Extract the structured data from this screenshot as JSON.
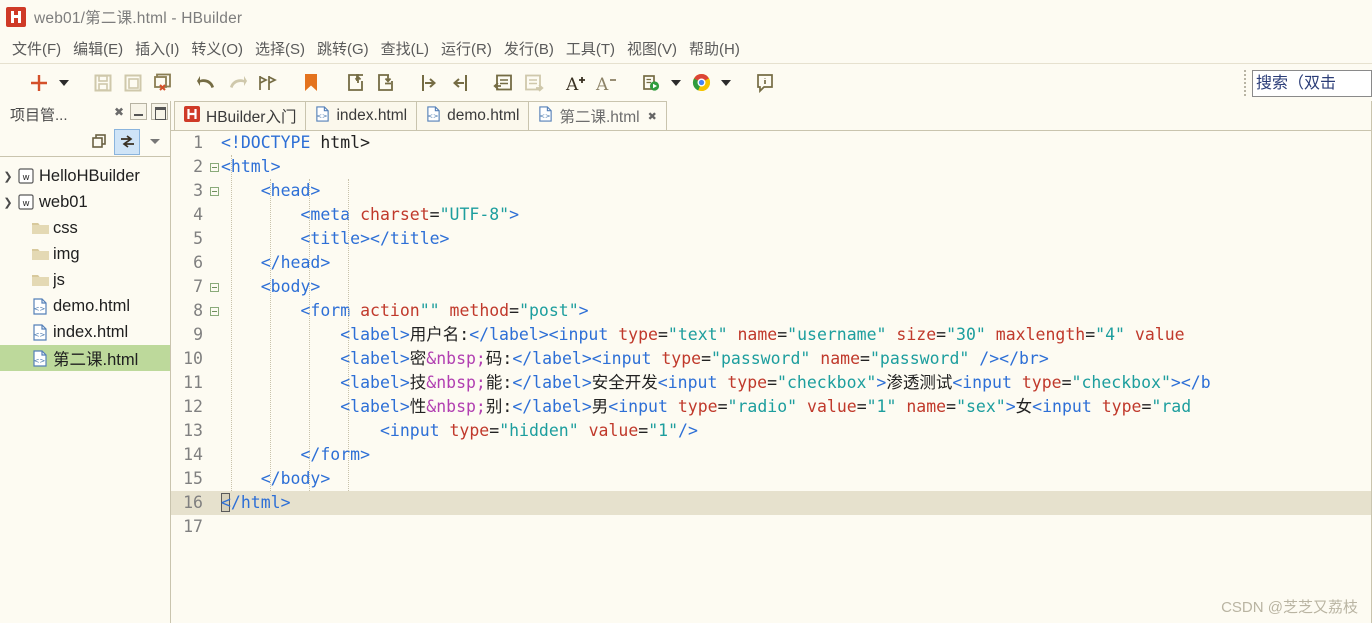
{
  "window": {
    "title": "web01/第二课.html  -  HBuilder",
    "logo_icon": "hbuilder-logo-icon"
  },
  "menubar": {
    "items": [
      {
        "label": "文件(F)",
        "name": "menu-file"
      },
      {
        "label": "编辑(E)",
        "name": "menu-edit"
      },
      {
        "label": "插入(I)",
        "name": "menu-insert"
      },
      {
        "label": "转义(O)",
        "name": "menu-escape"
      },
      {
        "label": "选择(S)",
        "name": "menu-select"
      },
      {
        "label": "跳转(G)",
        "name": "menu-goto"
      },
      {
        "label": "查找(L)",
        "name": "menu-find"
      },
      {
        "label": "运行(R)",
        "name": "menu-run"
      },
      {
        "label": "发行(B)",
        "name": "menu-publish"
      },
      {
        "label": "工具(T)",
        "name": "menu-tools"
      },
      {
        "label": "视图(V)",
        "name": "menu-view"
      },
      {
        "label": "帮助(H)",
        "name": "menu-help"
      }
    ]
  },
  "toolbar": {
    "icons": [
      "new-file-icon",
      "new-file-dropdown-icon",
      "save-icon",
      "save-all-icon",
      "close-file-icon",
      "undo-icon",
      "redo-icon",
      "format-icon",
      "bookmark-icon",
      "export-icon",
      "import-icon",
      "indent-right-icon",
      "indent-left-icon",
      "comment-icon",
      "uncomment-icon",
      "font-increase-icon",
      "font-decrease-icon",
      "run-browser-icon",
      "run-browser-dropdown-icon",
      "chrome-icon",
      "chrome-dropdown-icon",
      "info-icon"
    ],
    "search": {
      "value": "搜索（双击",
      "placeholder": "搜索（双击Ctrl）"
    }
  },
  "sidebar": {
    "title": "项目管...",
    "close_icon": "close-icon",
    "minimize_icon": "minimize-icon",
    "maximize_icon": "maximize-icon",
    "toolbar_icons": [
      "collapse-all-icon",
      "link-with-editor-icon",
      "view-menu-icon"
    ],
    "tree": [
      {
        "label": "HelloHBuilder",
        "icon": "project-icon",
        "twisty": "collapsed",
        "indent": 0,
        "selected": false,
        "name": "tree-item-hellohbuilder"
      },
      {
        "label": "web01",
        "icon": "project-icon",
        "twisty": "expanded",
        "indent": 0,
        "selected": false,
        "name": "tree-item-web01"
      },
      {
        "label": "css",
        "icon": "folder-icon",
        "twisty": "none",
        "indent": 1,
        "selected": false,
        "name": "tree-item-css"
      },
      {
        "label": "img",
        "icon": "folder-icon",
        "twisty": "none",
        "indent": 1,
        "selected": false,
        "name": "tree-item-img"
      },
      {
        "label": "js",
        "icon": "folder-icon",
        "twisty": "none",
        "indent": 1,
        "selected": false,
        "name": "tree-item-js"
      },
      {
        "label": "demo.html",
        "icon": "html-file-icon",
        "twisty": "none",
        "indent": 1,
        "selected": false,
        "name": "tree-item-demo-html"
      },
      {
        "label": "index.html",
        "icon": "html-file-icon",
        "twisty": "none",
        "indent": 1,
        "selected": false,
        "name": "tree-item-index-html"
      },
      {
        "label": "第二课.html",
        "icon": "html-file-icon",
        "twisty": "none",
        "indent": 1,
        "selected": true,
        "name": "tree-item-dierke-html"
      }
    ]
  },
  "tabs": [
    {
      "label": "HBuilder入门",
      "icon": "hbuilder-logo-icon",
      "active": false,
      "closable": false,
      "name": "tab-hbuilder-intro"
    },
    {
      "label": "index.html",
      "icon": "html-file-icon",
      "active": false,
      "closable": false,
      "name": "tab-index-html"
    },
    {
      "label": "demo.html",
      "icon": "html-file-icon",
      "active": false,
      "closable": false,
      "name": "tab-demo-html"
    },
    {
      "label": "第二课.html",
      "icon": "html-file-icon",
      "active": true,
      "closable": true,
      "close_icon": "close-icon",
      "name": "tab-dierke-html"
    }
  ],
  "editor": {
    "current_line": 16,
    "lines": [
      {
        "n": 1,
        "fold": false,
        "current": false,
        "tokens": [
          {
            "t": "doctype",
            "v": "<!DOCTYPE"
          },
          {
            "t": "plain",
            "v": " html>"
          }
        ]
      },
      {
        "n": 2,
        "fold": true,
        "current": false,
        "tokens": [
          {
            "t": "tag",
            "v": "<html>"
          }
        ]
      },
      {
        "n": 3,
        "fold": true,
        "current": false,
        "tokens": [
          {
            "t": "plain",
            "v": "    "
          },
          {
            "t": "tag",
            "v": "<head>"
          }
        ]
      },
      {
        "n": 4,
        "fold": false,
        "current": false,
        "tokens": [
          {
            "t": "plain",
            "v": "        "
          },
          {
            "t": "tag",
            "v": "<meta"
          },
          {
            "t": "plain",
            "v": " "
          },
          {
            "t": "attr",
            "v": "charset"
          },
          {
            "t": "plain",
            "v": "="
          },
          {
            "t": "str",
            "v": "\"UTF-8\""
          },
          {
            "t": "tag",
            "v": ">"
          }
        ]
      },
      {
        "n": 5,
        "fold": false,
        "current": false,
        "tokens": [
          {
            "t": "plain",
            "v": "        "
          },
          {
            "t": "tag",
            "v": "<title></title>"
          }
        ]
      },
      {
        "n": 6,
        "fold": false,
        "current": false,
        "tokens": [
          {
            "t": "plain",
            "v": "    "
          },
          {
            "t": "tag",
            "v": "</head>"
          }
        ]
      },
      {
        "n": 7,
        "fold": true,
        "current": false,
        "tokens": [
          {
            "t": "plain",
            "v": "    "
          },
          {
            "t": "tag",
            "v": "<body>"
          }
        ]
      },
      {
        "n": 8,
        "fold": true,
        "current": false,
        "tokens": [
          {
            "t": "plain",
            "v": "        "
          },
          {
            "t": "tag",
            "v": "<form"
          },
          {
            "t": "plain",
            "v": " "
          },
          {
            "t": "attr",
            "v": "action"
          },
          {
            "t": "str",
            "v": "\"\""
          },
          {
            "t": "plain",
            "v": " "
          },
          {
            "t": "attr",
            "v": "method"
          },
          {
            "t": "plain",
            "v": "="
          },
          {
            "t": "str",
            "v": "\"post\""
          },
          {
            "t": "tag",
            "v": ">"
          }
        ]
      },
      {
        "n": 9,
        "fold": false,
        "current": false,
        "tokens": [
          {
            "t": "plain",
            "v": "            "
          },
          {
            "t": "tag",
            "v": "<label>"
          },
          {
            "t": "txt",
            "v": "用户名:"
          },
          {
            "t": "tag",
            "v": "</label><input"
          },
          {
            "t": "plain",
            "v": " "
          },
          {
            "t": "attr",
            "v": "type"
          },
          {
            "t": "plain",
            "v": "="
          },
          {
            "t": "str",
            "v": "\"text\""
          },
          {
            "t": "plain",
            "v": " "
          },
          {
            "t": "attr",
            "v": "name"
          },
          {
            "t": "plain",
            "v": "="
          },
          {
            "t": "str",
            "v": "\"username\""
          },
          {
            "t": "plain",
            "v": " "
          },
          {
            "t": "attr",
            "v": "size"
          },
          {
            "t": "plain",
            "v": "="
          },
          {
            "t": "str",
            "v": "\"30\""
          },
          {
            "t": "plain",
            "v": " "
          },
          {
            "t": "attr",
            "v": "maxlength"
          },
          {
            "t": "plain",
            "v": "="
          },
          {
            "t": "str",
            "v": "\"4\""
          },
          {
            "t": "plain",
            "v": " "
          },
          {
            "t": "attr",
            "v": "value"
          }
        ]
      },
      {
        "n": 10,
        "fold": false,
        "current": false,
        "tokens": [
          {
            "t": "plain",
            "v": "            "
          },
          {
            "t": "tag",
            "v": "<label>"
          },
          {
            "t": "txt",
            "v": "密"
          },
          {
            "t": "ent",
            "v": "&nbsp;"
          },
          {
            "t": "txt",
            "v": "码:"
          },
          {
            "t": "tag",
            "v": "</label><input"
          },
          {
            "t": "plain",
            "v": " "
          },
          {
            "t": "attr",
            "v": "type"
          },
          {
            "t": "plain",
            "v": "="
          },
          {
            "t": "str",
            "v": "\"password\""
          },
          {
            "t": "plain",
            "v": " "
          },
          {
            "t": "attr",
            "v": "name"
          },
          {
            "t": "plain",
            "v": "="
          },
          {
            "t": "str",
            "v": "\"password\""
          },
          {
            "t": "plain",
            "v": " "
          },
          {
            "t": "tag",
            "v": "/></br>"
          }
        ]
      },
      {
        "n": 11,
        "fold": false,
        "current": false,
        "tokens": [
          {
            "t": "plain",
            "v": "            "
          },
          {
            "t": "tag",
            "v": "<label>"
          },
          {
            "t": "txt",
            "v": "技"
          },
          {
            "t": "ent",
            "v": "&nbsp;"
          },
          {
            "t": "txt",
            "v": "能:"
          },
          {
            "t": "tag",
            "v": "</label>"
          },
          {
            "t": "txt",
            "v": "安全开发"
          },
          {
            "t": "tag",
            "v": "<input"
          },
          {
            "t": "plain",
            "v": " "
          },
          {
            "t": "attr",
            "v": "type"
          },
          {
            "t": "plain",
            "v": "="
          },
          {
            "t": "str",
            "v": "\"checkbox\""
          },
          {
            "t": "tag",
            "v": ">"
          },
          {
            "t": "txt",
            "v": "渗透测试"
          },
          {
            "t": "tag",
            "v": "<input"
          },
          {
            "t": "plain",
            "v": " "
          },
          {
            "t": "attr",
            "v": "type"
          },
          {
            "t": "plain",
            "v": "="
          },
          {
            "t": "str",
            "v": "\"checkbox\""
          },
          {
            "t": "tag",
            "v": "></b"
          }
        ]
      },
      {
        "n": 12,
        "fold": false,
        "current": false,
        "tokens": [
          {
            "t": "plain",
            "v": "            "
          },
          {
            "t": "tag",
            "v": "<label>"
          },
          {
            "t": "txt",
            "v": "性"
          },
          {
            "t": "ent",
            "v": "&nbsp;"
          },
          {
            "t": "txt",
            "v": "别:"
          },
          {
            "t": "tag",
            "v": "</label>"
          },
          {
            "t": "txt",
            "v": "男"
          },
          {
            "t": "tag",
            "v": "<input"
          },
          {
            "t": "plain",
            "v": " "
          },
          {
            "t": "attr",
            "v": "type"
          },
          {
            "t": "plain",
            "v": "="
          },
          {
            "t": "str",
            "v": "\"radio\""
          },
          {
            "t": "plain",
            "v": " "
          },
          {
            "t": "attr",
            "v": "value"
          },
          {
            "t": "plain",
            "v": "="
          },
          {
            "t": "str",
            "v": "\"1\""
          },
          {
            "t": "plain",
            "v": " "
          },
          {
            "t": "attr",
            "v": "name"
          },
          {
            "t": "plain",
            "v": "="
          },
          {
            "t": "str",
            "v": "\"sex\""
          },
          {
            "t": "tag",
            "v": ">"
          },
          {
            "t": "txt",
            "v": "女"
          },
          {
            "t": "tag",
            "v": "<input"
          },
          {
            "t": "plain",
            "v": " "
          },
          {
            "t": "attr",
            "v": "type"
          },
          {
            "t": "plain",
            "v": "="
          },
          {
            "t": "str",
            "v": "\"rad"
          }
        ]
      },
      {
        "n": 13,
        "fold": false,
        "current": false,
        "tokens": [
          {
            "t": "plain",
            "v": "                "
          },
          {
            "t": "tag",
            "v": "<input"
          },
          {
            "t": "plain",
            "v": " "
          },
          {
            "t": "attr",
            "v": "type"
          },
          {
            "t": "plain",
            "v": "="
          },
          {
            "t": "str",
            "v": "\"hidden\""
          },
          {
            "t": "plain",
            "v": " "
          },
          {
            "t": "attr",
            "v": "value"
          },
          {
            "t": "plain",
            "v": "="
          },
          {
            "t": "str",
            "v": "\"1\""
          },
          {
            "t": "tag",
            "v": "/>"
          }
        ]
      },
      {
        "n": 14,
        "fold": false,
        "current": false,
        "tokens": [
          {
            "t": "plain",
            "v": "        "
          },
          {
            "t": "tag",
            "v": "</form>"
          }
        ]
      },
      {
        "n": 15,
        "fold": false,
        "current": false,
        "tokens": [
          {
            "t": "plain",
            "v": "    "
          },
          {
            "t": "tag",
            "v": "</body>"
          }
        ]
      },
      {
        "n": 16,
        "fold": false,
        "current": true,
        "cursor": true,
        "tokens": [
          {
            "t": "tag",
            "v": "</html>"
          }
        ]
      },
      {
        "n": 17,
        "fold": false,
        "current": false,
        "tokens": []
      }
    ]
  },
  "watermark": "CSDN @芝芝又荔枝",
  "colors": {
    "background": "#fdfbf2",
    "accent": "#cf3a27",
    "selection": "#bdd99b",
    "current_line": "#e6e1cd",
    "tag": "#2d6fd6",
    "attr": "#c0392b",
    "string": "#1d9e9e",
    "entity": "#b13fb1"
  }
}
